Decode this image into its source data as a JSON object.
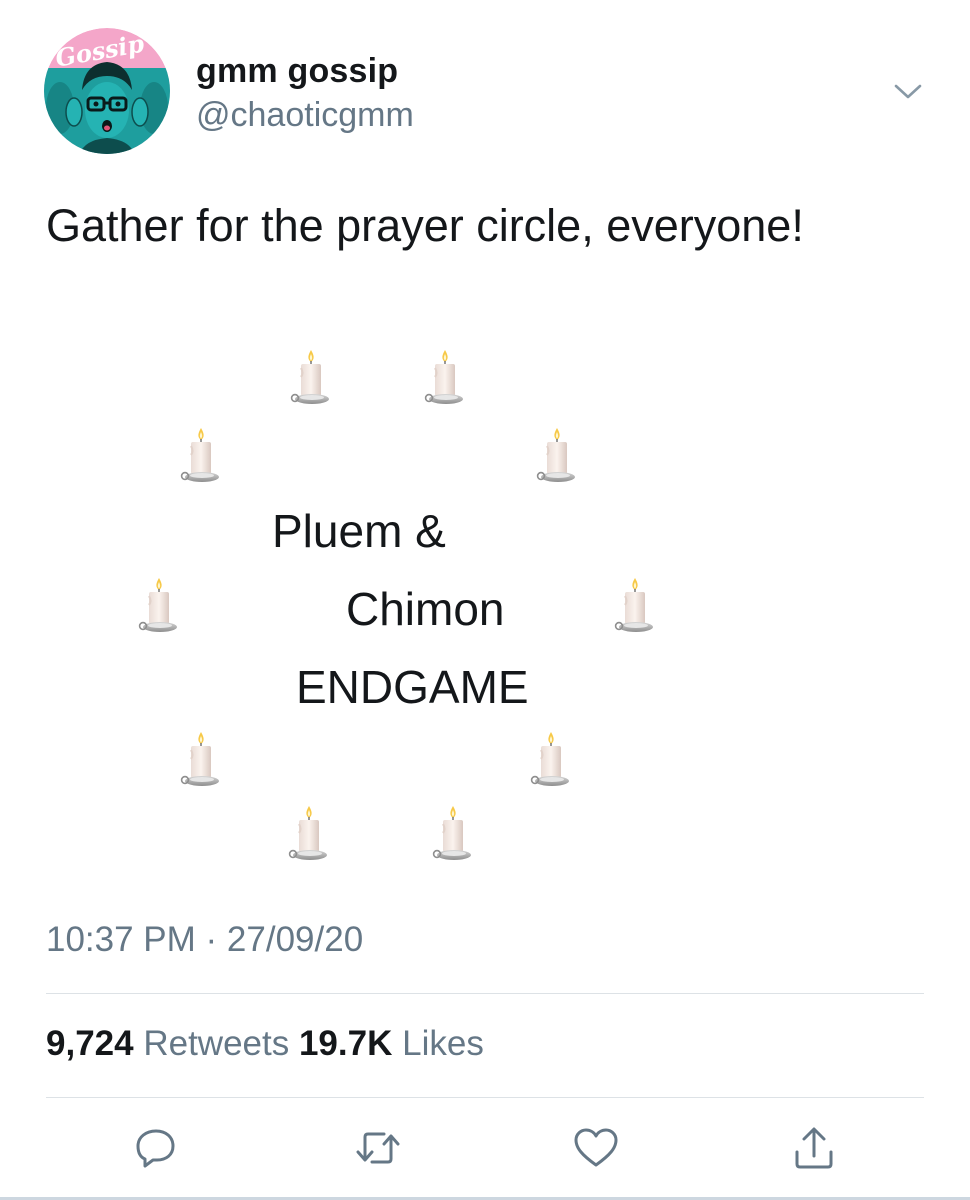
{
  "user": {
    "display_name": "gmm gossip",
    "handle": "@chaoticgmm",
    "avatar_logo_text": "Gossip"
  },
  "tweet": {
    "text": "Gather for the prayer circle, everyone!",
    "circle_lines": [
      "Pluem &",
      "Chimon",
      "ENDGAME"
    ],
    "candle_icon": "candle-icon",
    "timestamp": "10:37 PM · 27/09/20"
  },
  "stats": {
    "retweets_count": "9,724",
    "retweets_label": "Retweets",
    "likes_count": "19.7K",
    "likes_label": "Likes"
  },
  "actions": [
    "reply-icon",
    "retweet-icon",
    "like-icon",
    "share-icon"
  ],
  "colors": {
    "text_primary": "#14171a",
    "text_secondary": "#657786",
    "avatar_teal": "#1e9e9e",
    "avatar_pink": "#f4a6c9",
    "divider": "#dde2e6"
  }
}
